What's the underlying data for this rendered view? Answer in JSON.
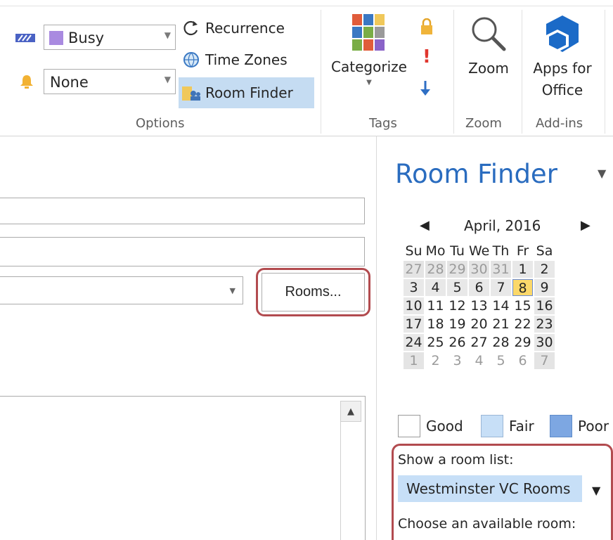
{
  "ribbon": {
    "options": {
      "show_as": "Busy",
      "reminder": "None",
      "recurrence": "Recurrence",
      "time_zones": "Time Zones",
      "room_finder": "Room Finder",
      "group_label": "Options"
    },
    "tags": {
      "categorize": "Categorize",
      "group_label": "Tags"
    },
    "zoom": {
      "label": "Zoom",
      "group_label": "Zoom"
    },
    "addins": {
      "label_line1": "Apps for",
      "label_line2": "Office",
      "group_label": "Add-ins"
    }
  },
  "form": {
    "rooms_button": "Rooms..."
  },
  "room_finder": {
    "title": "Room Finder",
    "month": "April, 2016",
    "weekdays": [
      "Su",
      "Mo",
      "Tu",
      "We",
      "Th",
      "Fr",
      "Sa"
    ],
    "weeks": [
      [
        "27",
        "28",
        "29",
        "30",
        "31",
        "1",
        "2"
      ],
      [
        "3",
        "4",
        "5",
        "6",
        "7",
        "8",
        "9"
      ],
      [
        "10",
        "11",
        "12",
        "13",
        "14",
        "15",
        "16"
      ],
      [
        "17",
        "18",
        "19",
        "20",
        "21",
        "22",
        "23"
      ],
      [
        "24",
        "25",
        "26",
        "27",
        "28",
        "29",
        "30"
      ],
      [
        "1",
        "2",
        "3",
        "4",
        "5",
        "6",
        "7"
      ]
    ],
    "legend": {
      "good": "Good",
      "fair": "Fair",
      "poor": "Poor"
    },
    "show_room_list_label": "Show a room list:",
    "room_list_value": "Westminster VC Rooms",
    "choose_room_label": "Choose an available room:"
  },
  "colors": {
    "accent_title": "#2a6cbf",
    "highlight": "#c5dcf2",
    "today": "#fbd86a",
    "callout": "#b24b4f"
  }
}
